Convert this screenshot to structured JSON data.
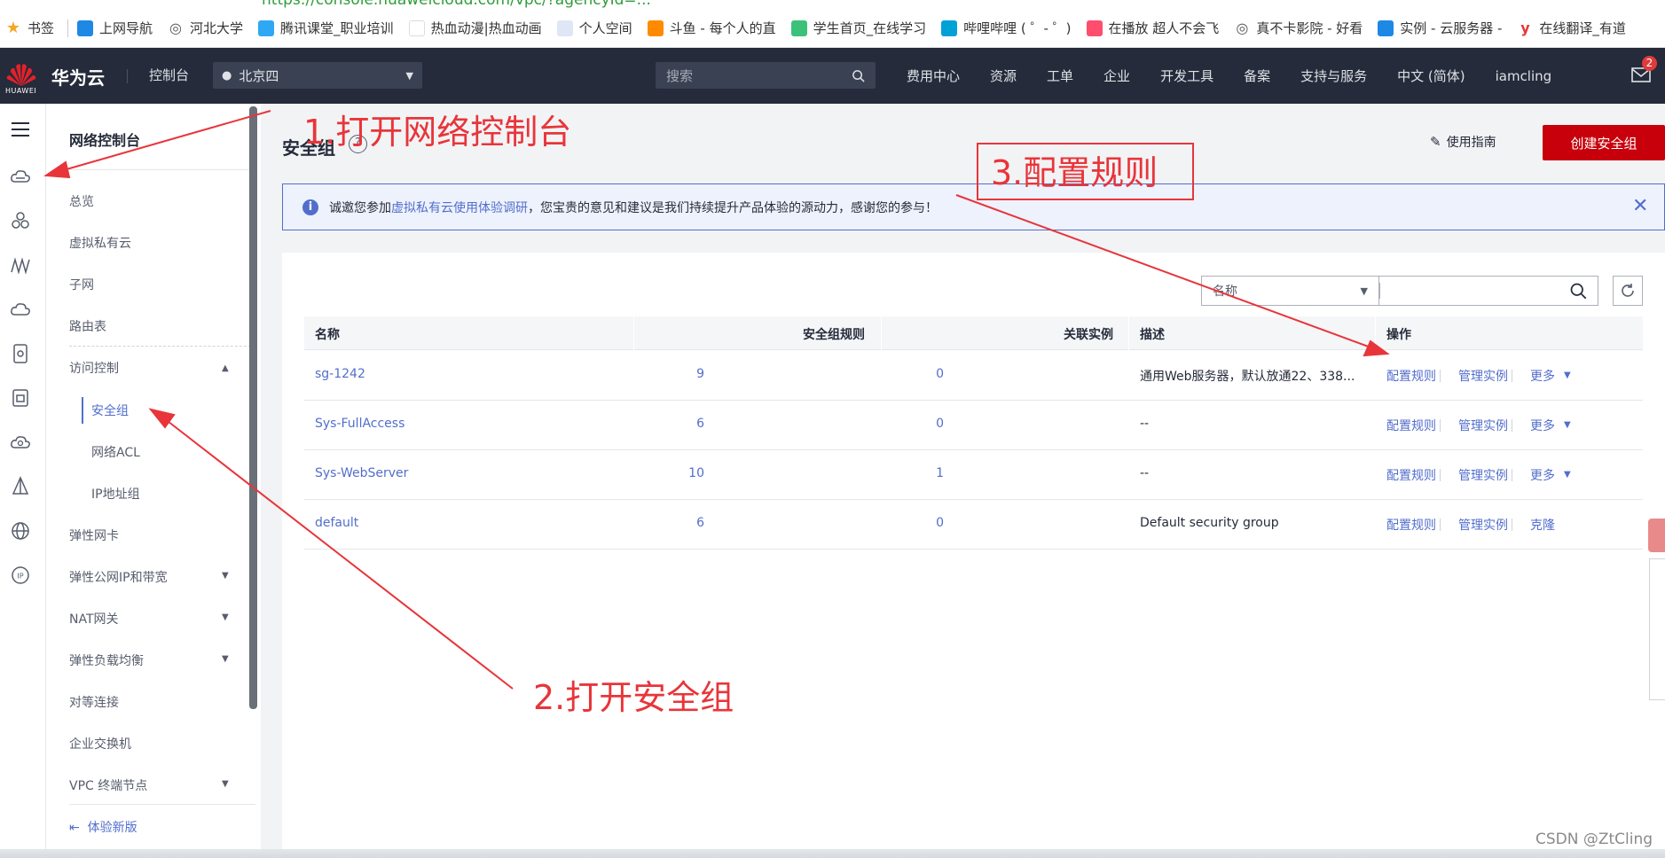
{
  "browser": {
    "url": "https://console.huaweicloud.com/vpc/?agencyId=...",
    "bookmarks": [
      {
        "label": "书签",
        "icon": "star-icon",
        "color": "#f5a623"
      },
      {
        "label": "上网导航",
        "icon": "ie-icon",
        "color": "#1e88e5"
      },
      {
        "label": "河北大学",
        "icon": "globe-icon",
        "color": "#555555"
      },
      {
        "label": "腾讯课堂_职业培训",
        "icon": "tencent-classroom-icon",
        "color": "#2ea8f5"
      },
      {
        "label": "热血动漫|热血动画",
        "icon": "blank-icon",
        "color": "#ffffff"
      },
      {
        "label": "个人空间",
        "icon": "page-icon",
        "color": "#dfe6f5"
      },
      {
        "label": "斗鱼 - 每个人的直",
        "icon": "douyu-icon",
        "color": "#ff8a00"
      },
      {
        "label": "学生首页_在线学习",
        "icon": "wave-icon",
        "color": "#3cc17b"
      },
      {
        "label": "哔哩哔哩 ( ゜- ゜)",
        "icon": "bilibili-icon",
        "color": "#00a1d6"
      },
      {
        "label": "在播放 超人不会飞",
        "icon": "player-icon",
        "color": "#ff4d6d"
      },
      {
        "label": "真不卡影院 - 好看",
        "icon": "globe-icon",
        "color": "#555555"
      },
      {
        "label": "实例 - 云服务器 -",
        "icon": "cloud-icon",
        "color": "#1e88e5"
      },
      {
        "label": "在线翻译_有道",
        "icon": "youdao-icon",
        "color": "#e53935"
      }
    ]
  },
  "topnav": {
    "brand": "华为云",
    "logo_text": "HUAWEI",
    "console": "控制台",
    "region": "北京四",
    "search_placeholder": "搜索",
    "links": [
      "费用中心",
      "资源",
      "工单",
      "企业",
      "开发工具",
      "备案",
      "支持与服务",
      "中文 (简体)",
      "iamcling"
    ],
    "badge_count": "2"
  },
  "sidebar": {
    "title": "网络控制台",
    "items": {
      "overview": "总览",
      "vpc": "虚拟私有云",
      "subnet": "子网",
      "route_table": "路由表",
      "access_control": "访问控制",
      "security_group": "安全组",
      "network_acl": "网络ACL",
      "ip_group": "IP地址组",
      "eni": "弹性网卡",
      "eip": "弹性公网IP和带宽",
      "nat": "NAT网关",
      "elb": "弹性负载均衡",
      "peering": "对等连接",
      "enterprise_router": "企业交换机",
      "vpc_endpoint": "VPC 终端节点",
      "new_version": "体验新版"
    }
  },
  "main": {
    "title": "安全组",
    "guide": "使用指南",
    "create_button": "创建安全组",
    "notice": {
      "prefix": "诚邀您参加",
      "link": "虚拟私有云使用体验调研",
      "suffix": "，您宝贵的意见和建议是我们持续提升产品体验的源动力，感谢您的参与！"
    },
    "filter": {
      "field": "名称",
      "value": ""
    },
    "table": {
      "headers": {
        "name": "名称",
        "rules": "安全组规则",
        "instances": "关联实例",
        "description": "描述",
        "actions": "操作"
      },
      "rows": [
        {
          "name": "sg-1242",
          "rules": "9",
          "instances": "0",
          "description": "通用Web服务器，默认放通22、338...",
          "ops": [
            "配置规则",
            "管理实例",
            "更多"
          ]
        },
        {
          "name": "Sys-FullAccess",
          "rules": "6",
          "instances": "0",
          "description": "--",
          "ops": [
            "配置规则",
            "管理实例",
            "更多"
          ]
        },
        {
          "name": "Sys-WebServer",
          "rules": "10",
          "instances": "1",
          "description": "--",
          "ops": [
            "配置规则",
            "管理实例",
            "更多"
          ]
        },
        {
          "name": "default",
          "rules": "6",
          "instances": "0",
          "description": "Default security group",
          "ops": [
            "配置规则",
            "管理实例",
            "克隆"
          ]
        }
      ]
    }
  },
  "annotations": {
    "step1": "1.打开网络控制台",
    "step2": "2.打开安全组",
    "step3": "3.配置规则",
    "color": "#e8353a"
  },
  "watermark": "CSDN @ZtCling"
}
